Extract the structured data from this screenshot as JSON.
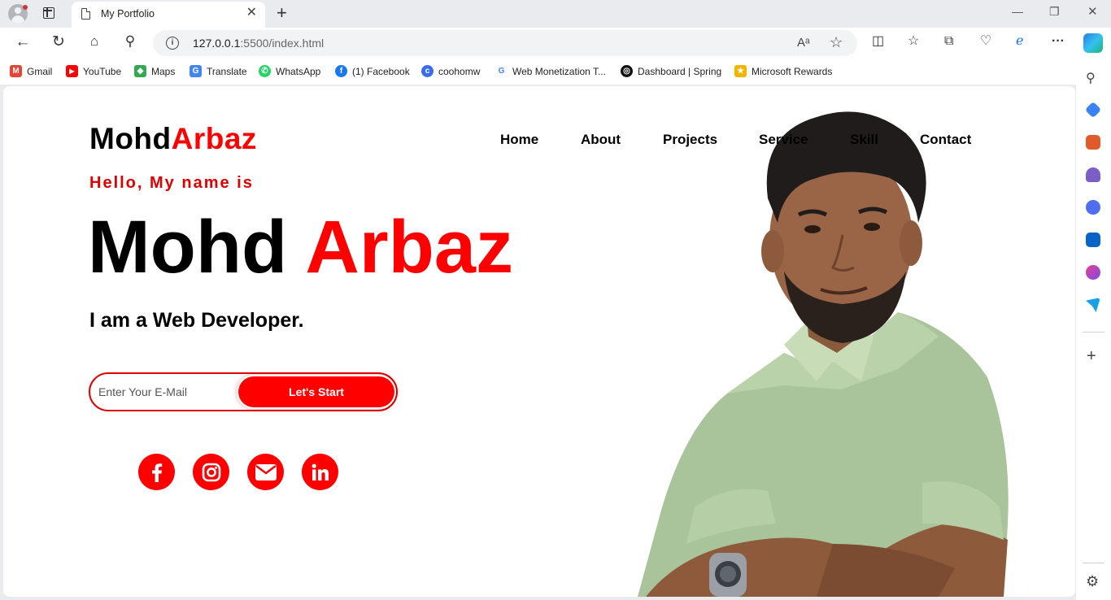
{
  "browser": {
    "tab_title": "My Portfolio",
    "url_host": "127.0.0.1",
    "url_rest": ":5500/index.html",
    "bookmarks": [
      {
        "label": "Gmail",
        "icon": "gmail-icon",
        "color": "#ea4335"
      },
      {
        "label": "YouTube",
        "icon": "youtube-icon",
        "color": "#ff0000"
      },
      {
        "label": "Maps",
        "icon": "maps-icon",
        "color": "#34a853"
      },
      {
        "label": "Translate",
        "icon": "translate-icon",
        "color": "#4285f4"
      },
      {
        "label": "WhatsApp",
        "icon": "whatsapp-icon",
        "color": "#25d366"
      },
      {
        "label": "(1) Facebook",
        "icon": "facebook-icon",
        "color": "#1877f2"
      },
      {
        "label": "coohomw",
        "icon": "coohom-icon",
        "color": "#3b6cf0"
      },
      {
        "label": "Web Monetization T...",
        "icon": "google-icon",
        "color": "#4285f4"
      },
      {
        "label": "Dashboard | Spring",
        "icon": "spring-icon",
        "color": "#111111"
      },
      {
        "label": "Microsoft Rewards",
        "icon": "rewards-icon",
        "color": "#f4b400"
      }
    ]
  },
  "page": {
    "logo_first": "Mohd",
    "logo_second": "Arbaz",
    "nav": [
      "Home",
      "About",
      "Projects",
      "Service",
      "Skill",
      "Contact"
    ],
    "greeting": "Hello, My name is",
    "name_first": "Mohd",
    "name_second": "Arbaz",
    "role": "I am a Web Developer.",
    "email_placeholder": "Enter Your E-Mail",
    "cta_label": "Let's Start",
    "socials": [
      "facebook-icon",
      "instagram-icon",
      "mail-icon",
      "linkedin-icon"
    ],
    "accent_color": "#ff0000"
  }
}
